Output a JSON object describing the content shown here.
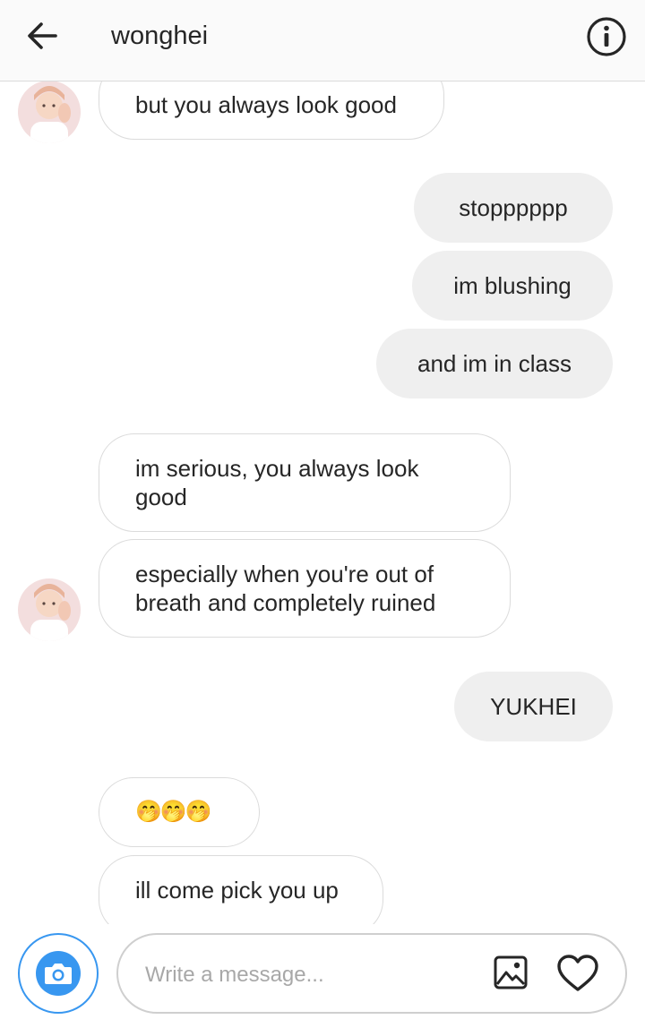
{
  "header": {
    "username": "wonghei",
    "back_icon": "arrow-left-icon",
    "info_icon": "info-icon"
  },
  "messages": [
    {
      "id": "m1",
      "direction": "incoming",
      "text": "but you always look good"
    },
    {
      "id": "m2",
      "direction": "outgoing",
      "text": "stopppppp"
    },
    {
      "id": "m3",
      "direction": "outgoing",
      "text": "im blushing"
    },
    {
      "id": "m4",
      "direction": "outgoing",
      "text": "and im in class"
    },
    {
      "id": "m5",
      "direction": "incoming",
      "text": "im serious, you always look good"
    },
    {
      "id": "m6",
      "direction": "incoming",
      "text": "especially when you're out of breath and completely ruined"
    },
    {
      "id": "m7",
      "direction": "outgoing",
      "text": "YUKHEI"
    },
    {
      "id": "m8",
      "direction": "incoming",
      "text": "🤭🤭🤭"
    },
    {
      "id": "m9",
      "direction": "incoming",
      "text": "ill come pick you up"
    }
  ],
  "composer": {
    "placeholder": "Write a message...",
    "camera_icon": "camera-icon",
    "gallery_icon": "image-icon",
    "like_icon": "heart-icon"
  },
  "colors": {
    "accent": "#3897f0",
    "outgoing_bubble": "#efefef",
    "incoming_border": "#dbdbdb",
    "header_bg": "#fafafa"
  }
}
